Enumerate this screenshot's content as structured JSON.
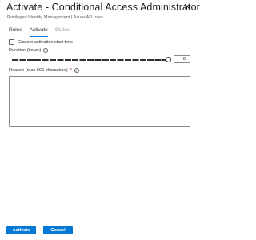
{
  "header": {
    "title": "Activate - Conditional Access Administrator",
    "subtitle": "Privileged Identity Management | Azure AD roles",
    "close_glyph": "✕"
  },
  "tabs": [
    {
      "label": "Roles",
      "state": "normal"
    },
    {
      "label": "Activate",
      "state": "active"
    },
    {
      "label": "Status",
      "state": "disabled"
    }
  ],
  "custom_start": {
    "label": "Custom activation start time",
    "checked": false
  },
  "duration": {
    "label": "Duration (hours)",
    "value": "8",
    "slider_position": 1.0
  },
  "reason": {
    "label": "Reason (max 500 characters)",
    "required_mark": "*",
    "value": ""
  },
  "info_glyph": "i",
  "footer": {
    "activate_label": "Activate",
    "cancel_label": "Cancel"
  },
  "colors": {
    "accent": "#0078d4",
    "required": "#a4262c",
    "disabled_text": "#a19f9d"
  }
}
